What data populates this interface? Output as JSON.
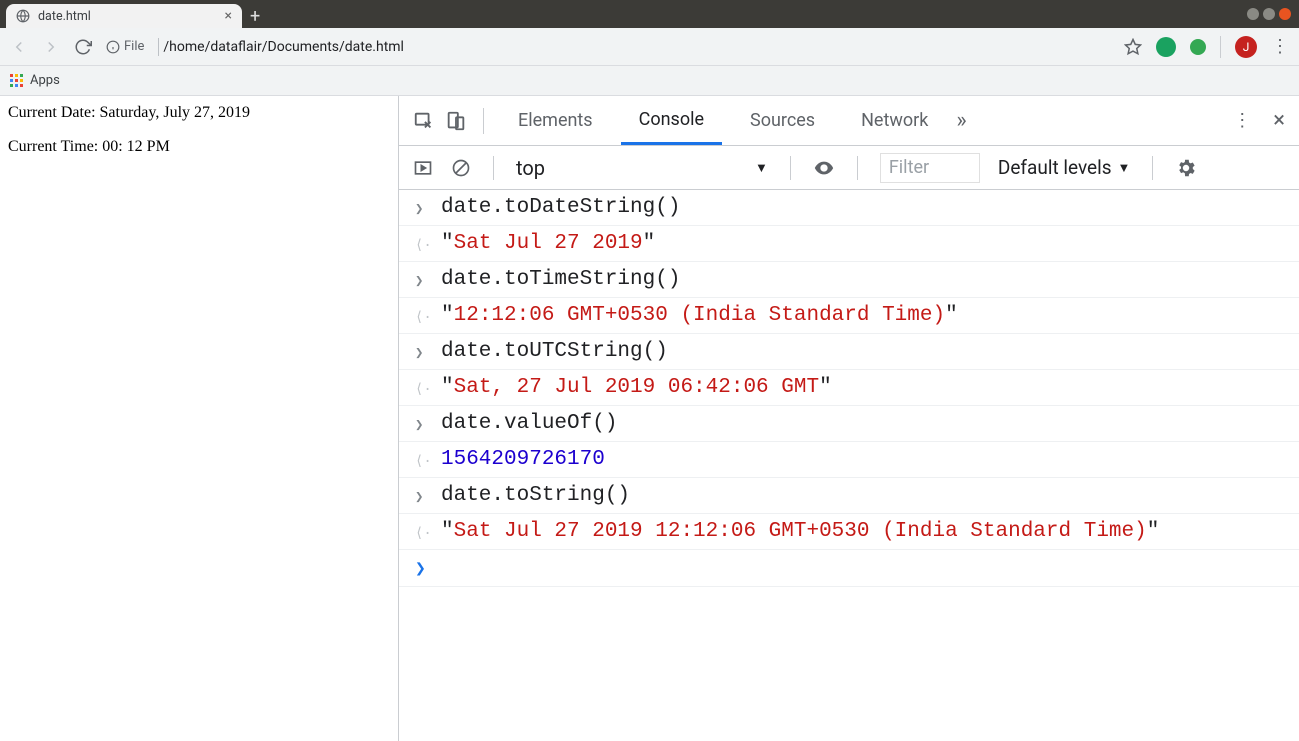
{
  "window": {
    "tab_title": "date.html",
    "new_tab_glyph": "+"
  },
  "toolbar": {
    "file_label": "File",
    "url_path": "/home/dataflair/Documents/date.html",
    "avatar_letter": "J"
  },
  "bookmarks": {
    "apps_label": "Apps"
  },
  "page": {
    "line1": "Current Date: Saturday, July 27, 2019",
    "line2": "Current Time: 00: 12 PM"
  },
  "devtools": {
    "tabs": {
      "elements": "Elements",
      "console": "Console",
      "sources": "Sources",
      "network": "Network"
    },
    "subbar": {
      "context": "top",
      "filter_placeholder": "Filter",
      "levels_label": "Default levels"
    },
    "console": [
      {
        "kind": "input",
        "text": "date.toDateString()"
      },
      {
        "kind": "output_str",
        "text": "\"Sat Jul 27 2019\""
      },
      {
        "kind": "input",
        "text": "date.toTimeString()"
      },
      {
        "kind": "output_str",
        "text": "\"12:12:06 GMT+0530 (India Standard Time)\""
      },
      {
        "kind": "input",
        "text": "date.toUTCString()"
      },
      {
        "kind": "output_str",
        "text": "\"Sat, 27 Jul 2019 06:42:06 GMT\""
      },
      {
        "kind": "input",
        "text": "date.valueOf()"
      },
      {
        "kind": "output_num",
        "text": "1564209726170"
      },
      {
        "kind": "input",
        "text": "date.toString()"
      },
      {
        "kind": "output_str",
        "text": "\"Sat Jul 27 2019 12:12:06 GMT+0530 (India Standard Time)\""
      }
    ]
  }
}
